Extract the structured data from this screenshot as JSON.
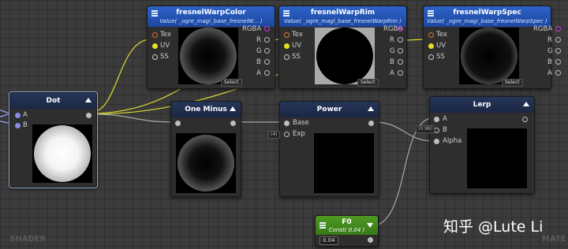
{
  "nodes": {
    "fresnel_color": {
      "title": "fresnelWarpColor",
      "subtitle": "Value( _ogre_magi_base_fresnelW... )",
      "inputs": [
        "Tex",
        "UV",
        "SS"
      ],
      "outputs": [
        "RGBA",
        "R",
        "G",
        "B",
        "A"
      ],
      "badge": "Select"
    },
    "fresnel_rim": {
      "title": "fresnelWarpRim",
      "subtitle": "Value( _ogre_magi_base_fresnelWarpRim )",
      "inputs": [
        "Tex",
        "UV",
        "SS"
      ],
      "outputs": [
        "RGBA",
        "R",
        "G",
        "B",
        "A"
      ],
      "badge": "Select"
    },
    "fresnel_spec": {
      "title": "fresnelWarpSpec",
      "subtitle": "Value( _ogre_magi_base_fresnelWarpSpec )",
      "inputs": [
        "Tex",
        "UV",
        "SS"
      ],
      "outputs": [
        "RGBA",
        "R",
        "G",
        "B",
        "A"
      ],
      "badge": "Select"
    },
    "dot": {
      "title": "Dot",
      "inputs": [
        "A",
        "B"
      ]
    },
    "one_minus": {
      "title": "One Minus"
    },
    "power": {
      "title": "Power",
      "inputs": [
        "Base",
        "Exp"
      ],
      "exp_label": "(4)"
    },
    "lerp": {
      "title": "Lerp",
      "inputs": [
        "A",
        "B",
        "Alpha"
      ],
      "b_label": "(0.96)"
    },
    "f0": {
      "title": "F0",
      "subtitle": "Const( 0.04 )",
      "value": "0.04"
    }
  },
  "corner_left": "SHADER",
  "corner_right": "MATE",
  "watermark": "知乎 @Lute Li",
  "colors": {
    "texture_header": "#2d62c7",
    "math_header": "#26365a",
    "const_header": "#4f9a23",
    "uv_port": "#e3df22",
    "tex_port": "#e07a2e",
    "rgba_port": "#c43ee0"
  }
}
